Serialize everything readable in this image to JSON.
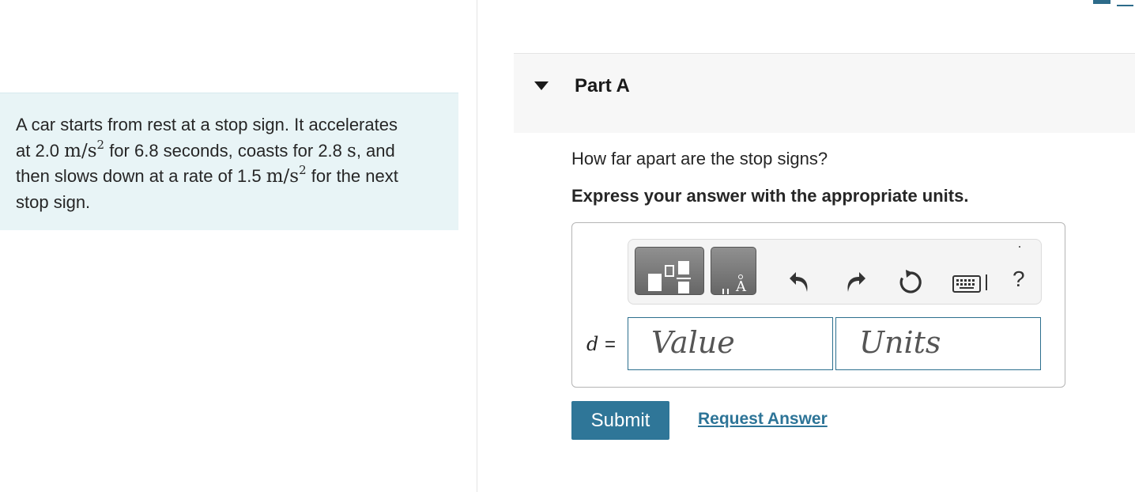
{
  "problem": {
    "line1": "A car starts from rest at a stop sign. It accelerates",
    "line2_pre": "at 2.0 ",
    "unit_accel_1": "m/s",
    "exp_1": "2",
    "line2_mid": " for 6.8 seconds, coasts for 2.8 ",
    "unit_s": "s",
    "line2_post": ", and",
    "line3_pre": "then slows down at a rate of 1.5 ",
    "unit_accel_2": "m/s",
    "exp_2": "2",
    "line3_post": " for the next",
    "line4": "stop sign."
  },
  "part": {
    "title": "Part A",
    "question": "How far apart are the stop signs?",
    "instruction": "Express your answer with the appropriate units."
  },
  "answer": {
    "variable": "d",
    "equals": "=",
    "value_placeholder": "Value",
    "units_placeholder": "Units",
    "help_label": "?"
  },
  "toolbar": {
    "icons": [
      "templates-icon",
      "units-icon",
      "undo-icon",
      "redo-icon",
      "reset-icon",
      "keyboard-icon",
      "help-icon"
    ]
  },
  "actions": {
    "submit_label": "Submit",
    "request_answer_label": "Request Answer"
  },
  "colors": {
    "problem_bg": "#e8f4f6",
    "submit_bg": "#2f7698",
    "link": "#2d7497",
    "field_border": "#2c6f8e"
  }
}
